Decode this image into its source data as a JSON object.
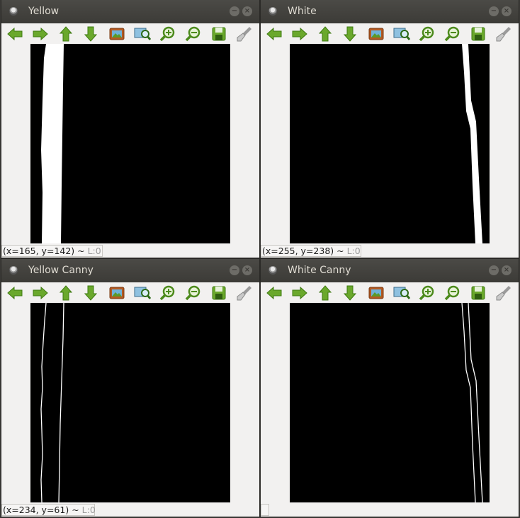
{
  "windows": [
    {
      "title": "Yellow",
      "status": {
        "coords": "(x=165, y=142)",
        "sep": " ~ ",
        "level": "L:0"
      },
      "image": "yellow-mask"
    },
    {
      "title": "White",
      "status": {
        "coords": "(x=255, y=238)",
        "sep": " ~ ",
        "level": "L:0"
      },
      "image": "white-mask"
    },
    {
      "title": "Yellow Canny",
      "status": {
        "coords": "(x=234, y=61)",
        "sep": " ~ ",
        "level": "L:0"
      },
      "image": "yellow-edges"
    },
    {
      "title": "White Canny",
      "status": {
        "coords": "",
        "sep": "",
        "level": ""
      },
      "image": "white-edges"
    }
  ],
  "window_controls": {
    "minimize": "−",
    "close": "×"
  },
  "toolbar_icons": [
    "pan-left-icon",
    "pan-right-icon",
    "pan-up-icon",
    "pan-down-icon",
    "zoom-fit-icon",
    "zoom-original-icon",
    "zoom-in-icon",
    "zoom-out-icon",
    "save-icon",
    "properties-icon"
  ],
  "colors": {
    "titlebar": "#3c3b37",
    "title_text": "#dfdbd2",
    "window_bg": "#f2f1f0",
    "icon_green": "#6aa82c",
    "image_bg": "#000000",
    "image_fg": "#ffffff"
  }
}
